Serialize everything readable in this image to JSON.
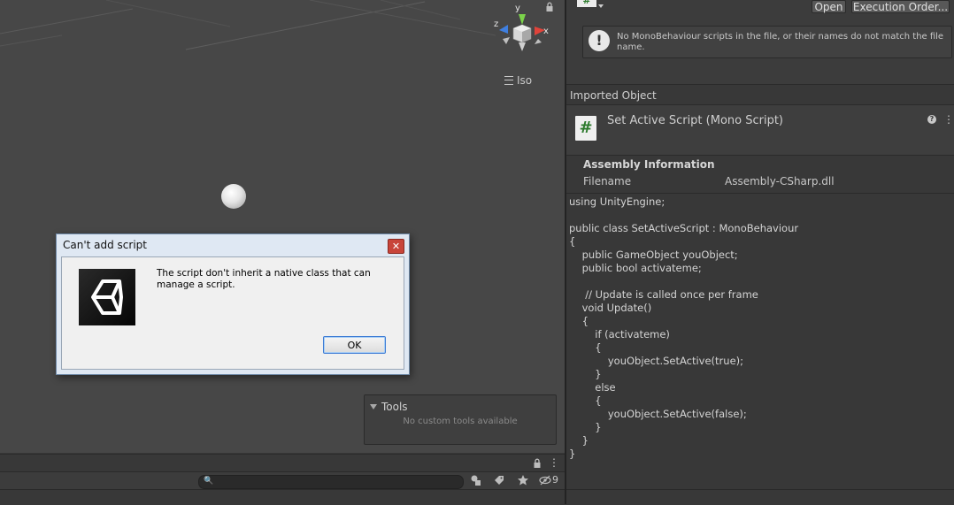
{
  "scene": {
    "gizmo": {
      "x_label": "x",
      "y_label": "y",
      "z_label": "z"
    },
    "projection_label": "Iso",
    "tools": {
      "title": "Tools",
      "empty_text": "No custom tools available"
    }
  },
  "dialog": {
    "title": "Can't add script",
    "close_glyph": "✕",
    "message": "The script don't inherit a native class that can manage a script.",
    "ok_label": "OK"
  },
  "bottom_toolbar": {
    "search_placeholder": "",
    "search_glyph": "🔍",
    "hidden_count": "9"
  },
  "inspector": {
    "top_file_glyph": "#",
    "open_label": "Open",
    "execution_order_label": "Execution Order...",
    "warning_glyph": "!",
    "warning_text": "No MonoBehaviour scripts in the file, or their names do not match the file name.",
    "imported_object_label": "Imported Object",
    "script_glyph": "#",
    "script_title": "Set Active Script (Mono Script)",
    "help_glyph": "?",
    "kebab_glyph": "⋮",
    "assembly_title": "Assembly Information",
    "filename_label": "Filename",
    "filename_value": "Assembly-CSharp.dll",
    "code": "using UnityEngine;\n\npublic class SetActiveScript : MonoBehaviour\n{\n    public GameObject youObject;\n    public bool activateme;\n\n     // Update is called once per frame\n    void Update()\n    {\n        if (activateme)\n        {\n            youObject.SetActive(true);\n        }\n        else\n        {\n            youObject.SetActive(false);\n        }\n    }\n}"
  },
  "colors": {
    "scene_bg": "#474747",
    "panel_bg": "#383838",
    "dialog_frame": "#dfe8f3",
    "dialog_close": "#c8453a",
    "script_icon_green": "#2c7a2c"
  }
}
